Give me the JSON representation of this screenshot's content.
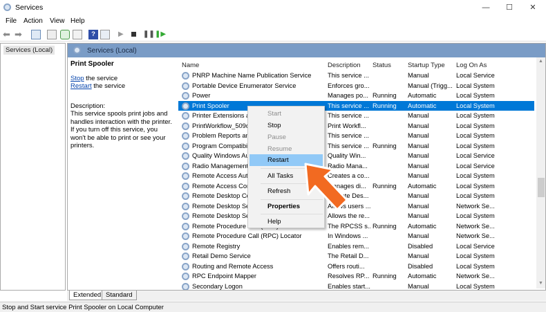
{
  "window": {
    "title": "Services",
    "min": "—",
    "max": "☐",
    "close": "✕"
  },
  "menu": [
    "File",
    "Action",
    "View",
    "Help"
  ],
  "toolbar": [
    "back-icon",
    "forward-icon",
    "show-console-tree-icon",
    "properties-icon",
    "refresh-icon",
    "export-icon",
    "help-icon",
    "show-hide-action-pane-icon",
    "start-service-icon",
    "stop-service-icon",
    "pause-service-icon",
    "restart-service-icon"
  ],
  "tree": {
    "root": "Services (Local)"
  },
  "pane": {
    "header": "Services (Local)"
  },
  "details": {
    "name": "Print Spooler",
    "stop_link": "Stop",
    "stop_rest": " the service",
    "restart_link": "Restart",
    "restart_rest": " the service",
    "desc_label": "Description:",
    "desc": "This service spools print jobs and handles interaction with the printer. If you turn off this service, you won't be able to print or see your printers."
  },
  "columns": [
    "Name",
    "Description",
    "Status",
    "Startup Type",
    "Log On As"
  ],
  "rows": [
    [
      "PNRP Machine Name Publication Service",
      "This service ...",
      "",
      "Manual",
      "Local Service"
    ],
    [
      "Portable Device Enumerator Service",
      "Enforces gro...",
      "",
      "Manual (Trigg...",
      "Local System"
    ],
    [
      "Power",
      "Manages po...",
      "Running",
      "Automatic",
      "Local System"
    ],
    [
      "Print Spooler",
      "This service ...",
      "Running",
      "Automatic",
      "Local System"
    ],
    [
      "Printer Extensions and Notifications",
      "This service ...",
      "",
      "Manual",
      "Local System"
    ],
    [
      "PrintWorkflow_509d1",
      "Print Workfl...",
      "",
      "Manual",
      "Local System"
    ],
    [
      "Problem Reports and Solutions",
      "This service ...",
      "",
      "Manual",
      "Local System"
    ],
    [
      "Program Compatibility Assistant",
      "This service ...",
      "Running",
      "Manual",
      "Local System"
    ],
    [
      "Quality Windows Audio Video",
      "Quality Win...",
      "",
      "Manual",
      "Local Service"
    ],
    [
      "Radio Management Service",
      "Radio Mana...",
      "",
      "Manual",
      "Local Service"
    ],
    [
      "Remote Access Auto Connection",
      "Creates a co...",
      "",
      "Manual",
      "Local System"
    ],
    [
      "Remote Access Connection Manager",
      "Manages di...",
      "Running",
      "Automatic",
      "Local System"
    ],
    [
      "Remote Desktop Configuration",
      "Remote Des...",
      "",
      "Manual",
      "Local System"
    ],
    [
      "Remote Desktop Services",
      "Allows users ...",
      "",
      "Manual",
      "Network Se..."
    ],
    [
      "Remote Desktop Services UserMode",
      "Allows the re...",
      "",
      "Manual",
      "Local System"
    ],
    [
      "Remote Procedure Call (RPC)",
      "The RPCSS s...",
      "Running",
      "Automatic",
      "Network Se..."
    ],
    [
      "Remote Procedure Call (RPC) Locator",
      "In Windows ...",
      "",
      "Manual",
      "Network Se..."
    ],
    [
      "Remote Registry",
      "Enables rem...",
      "",
      "Disabled",
      "Local Service"
    ],
    [
      "Retail Demo Service",
      "The Retail D...",
      "",
      "Manual",
      "Local System"
    ],
    [
      "Routing and Remote Access",
      "Offers routi...",
      "",
      "Disabled",
      "Local System"
    ],
    [
      "RPC Endpoint Mapper",
      "Resolves RP...",
      "Running",
      "Automatic",
      "Network Se..."
    ],
    [
      "Secondary Logon",
      "Enables start...",
      "",
      "Manual",
      "Local System"
    ]
  ],
  "selected_row": 3,
  "context_menu": {
    "start": "Start",
    "stop": "Stop",
    "pause": "Pause",
    "resume": "Resume",
    "restart": "Restart",
    "all_tasks": "All Tasks",
    "refresh": "Refresh",
    "properties": "Properties",
    "help": "Help"
  },
  "tabs": [
    "Extended",
    "Standard"
  ],
  "status": "Stop and Start service Print Spooler on Local Computer",
  "colors": {
    "selection": "#0078d7",
    "menu_highlight": "#91c9f7",
    "arrow": "#f26a21",
    "header_band": "#7a9cc6"
  }
}
